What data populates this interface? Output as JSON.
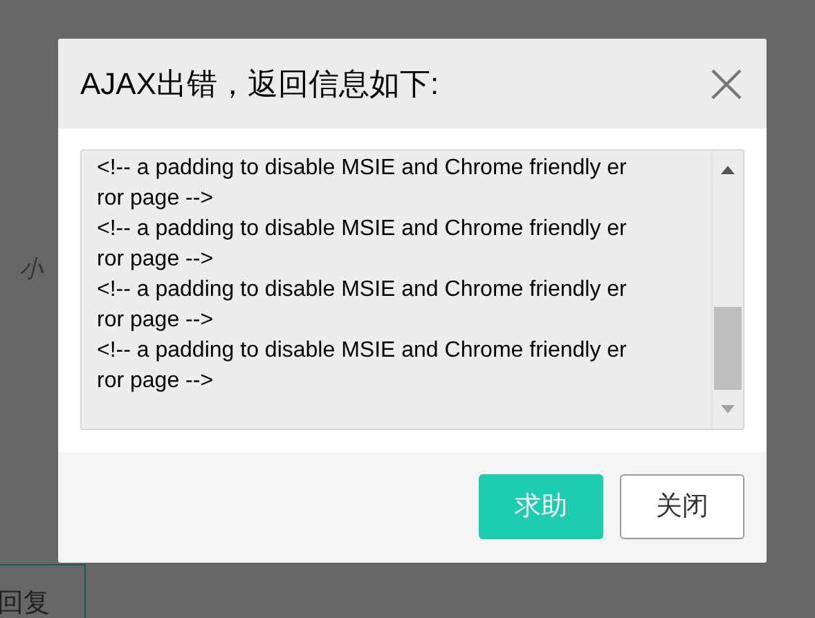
{
  "background": {
    "text_fragment": "小",
    "reply_button": "回复"
  },
  "dialog": {
    "title": "AJAX出错，返回信息如下:",
    "message_lines": [
      "<!-- a padding to disable MSIE and Chrome friendly er",
      "ror page -->",
      "<!-- a padding to disable MSIE and Chrome friendly er",
      "ror page -->",
      "<!-- a padding to disable MSIE and Chrome friendly er",
      "ror page -->",
      "<!-- a padding to disable MSIE and Chrome friendly er",
      "ror page -->"
    ],
    "buttons": [
      {
        "label": "求助",
        "kind": "primary"
      },
      {
        "label": "关闭",
        "kind": "default"
      }
    ]
  }
}
